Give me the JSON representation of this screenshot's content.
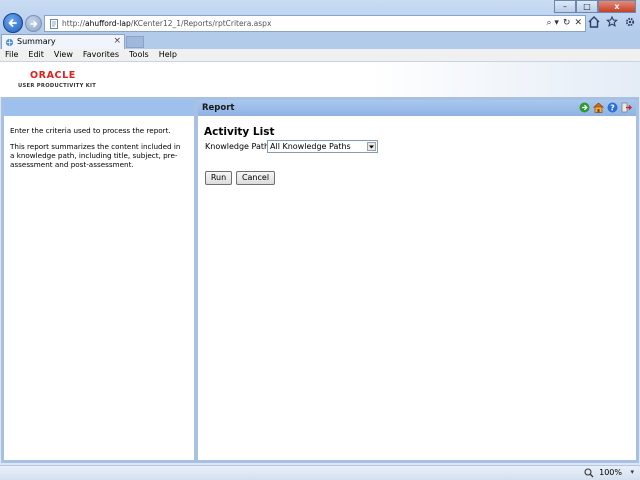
{
  "browser": {
    "url_prefix": "http://",
    "url_host": "ahufford-lap",
    "url_path": "/KCenter12_1/Reports/rptCritera.aspx",
    "tab_title": "Summary",
    "tab_close": "×",
    "win_minimize": "–",
    "win_maximize": "□",
    "win_close": "x",
    "addr_tools": [
      "⌕ ▾",
      "↻",
      "✕"
    ]
  },
  "menu": {
    "items": [
      "File",
      "Edit",
      "View",
      "Favorites",
      "Tools",
      "Help"
    ]
  },
  "header": {
    "brand": "ORACLE",
    "product": "USER PRODUCTIVITY KIT"
  },
  "left": {
    "instruction": "Enter the criteria used to process the report.",
    "description": "This report summarizes the content included in a knowledge path, including title, subject, pre-assessment and post-assessment."
  },
  "report": {
    "header_title": "Report",
    "title": "Activity List",
    "kp_label": "Knowledge Path",
    "kp_value": "All Knowledge Paths",
    "run_label": "Run",
    "cancel_label": "Cancel"
  },
  "status": {
    "zoom": "100%",
    "zoom_caret": "▾"
  },
  "colors": {
    "panel_border": "#a8c0e1",
    "panel_header": "#9ec0ec",
    "oracle_red": "#e0201c"
  }
}
